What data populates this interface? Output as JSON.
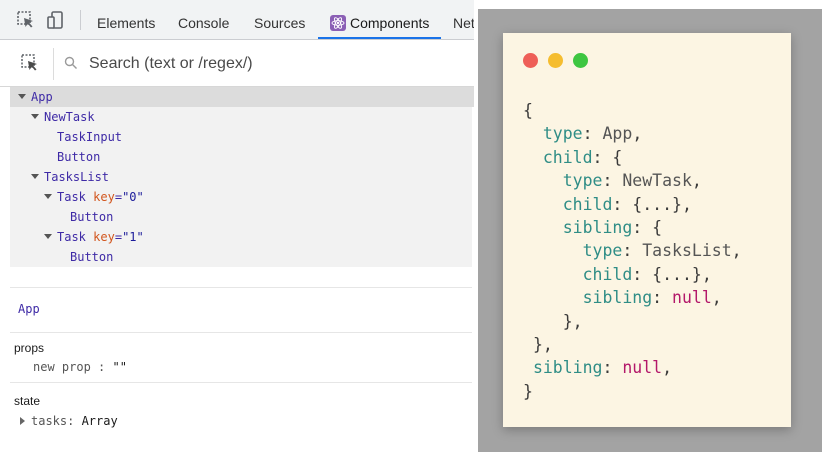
{
  "devtools": {
    "tabs": [
      {
        "label": "Elements"
      },
      {
        "label": "Console"
      },
      {
        "label": "Sources"
      },
      {
        "label": "Components"
      },
      {
        "label": "Net"
      }
    ],
    "search": {
      "placeholder": "Search (text or /regex/)"
    },
    "tree": {
      "app": "App",
      "newtask": "NewTask",
      "taskinput": "TaskInput",
      "button1": "Button",
      "taskslist": "TasksList",
      "task0_name": "Task",
      "task0_key": "key",
      "task0_eq": "=",
      "task0_val": "\"0\"",
      "button2": "Button",
      "task1_name": "Task",
      "task1_key": "key",
      "task1_eq": "=",
      "task1_val": "\"1\"",
      "button3": "Button"
    },
    "selected_component": "App",
    "props": {
      "title": "props",
      "key": "new prop",
      "sep": " : ",
      "value": "\"\""
    },
    "state": {
      "title": "state",
      "key": "tasks",
      "sep": ": ",
      "value": "Array"
    }
  },
  "code_card": {
    "window_dots": {
      "red": "#ee5f58",
      "yellow": "#f5bd2f",
      "green": "#3ec641"
    },
    "lines": {
      "l1": "{",
      "l2_key": "type",
      "l2_rest": ": ",
      "l2_val": "App",
      "l2_end": ",",
      "l3_key": "child",
      "l3_rest": ": {",
      "l4_key": "type",
      "l4_rest": ": ",
      "l4_val": "NewTask",
      "l4_end": ",",
      "l5_key": "child",
      "l5_rest": ": {...},",
      "l6_key": "sibling",
      "l6_rest": ": {",
      "l7_key": "type",
      "l7_rest": ": ",
      "l7_val": "TasksList",
      "l7_end": ",",
      "l8_key": "child",
      "l8_rest": ": {...},",
      "l9_key": "sibling",
      "l9_rest": ": ",
      "l9_val": "null",
      "l9_end": ",",
      "l10": "},",
      "l11": "},",
      "l12_key": "sibling",
      "l12_rest": ": ",
      "l12_val": "null",
      "l12_end": ",",
      "l13": "}"
    }
  }
}
